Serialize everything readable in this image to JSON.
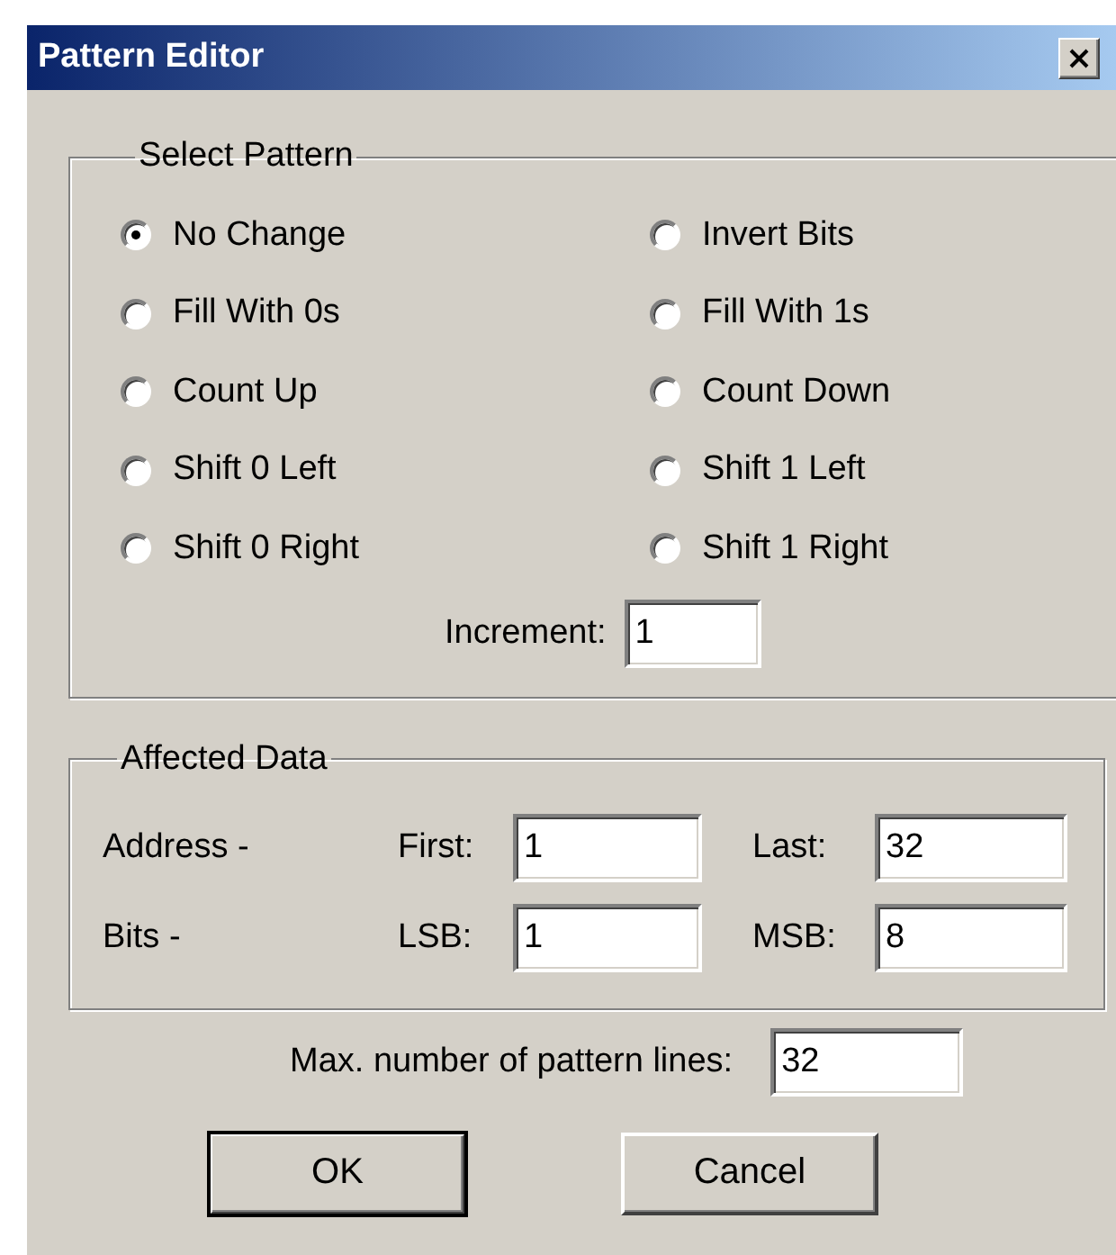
{
  "window": {
    "title": "Pattern Editor"
  },
  "select_pattern": {
    "title": "Select Pattern",
    "options": [
      {
        "label": "No Change",
        "selected": true
      },
      {
        "label": "Invert Bits",
        "selected": false
      },
      {
        "label": "Fill With 0s",
        "selected": false
      },
      {
        "label": "Fill With 1s",
        "selected": false
      },
      {
        "label": "Count Up",
        "selected": false
      },
      {
        "label": "Count Down",
        "selected": false
      },
      {
        "label": "Shift 0 Left",
        "selected": false
      },
      {
        "label": "Shift 1 Left",
        "selected": false
      },
      {
        "label": "Shift 0 Right",
        "selected": false
      },
      {
        "label": "Shift 1 Right",
        "selected": false
      }
    ],
    "increment": {
      "label": "Increment:",
      "value": "1"
    }
  },
  "affected_data": {
    "title": "Affected Data",
    "rows": [
      {
        "label": "Address -",
        "fields": [
          {
            "label": "First:",
            "value": "1"
          },
          {
            "label": "Last:",
            "value": "32"
          }
        ]
      },
      {
        "label": "Bits -",
        "fields": [
          {
            "label": "LSB:",
            "value": "1"
          },
          {
            "label": "MSB:",
            "value": "8"
          }
        ]
      }
    ]
  },
  "max_lines": {
    "label": "Max. number of pattern lines:",
    "value": "32"
  },
  "buttons": [
    {
      "label": "OK",
      "default": true
    },
    {
      "label": "Cancel",
      "default": false
    }
  ]
}
